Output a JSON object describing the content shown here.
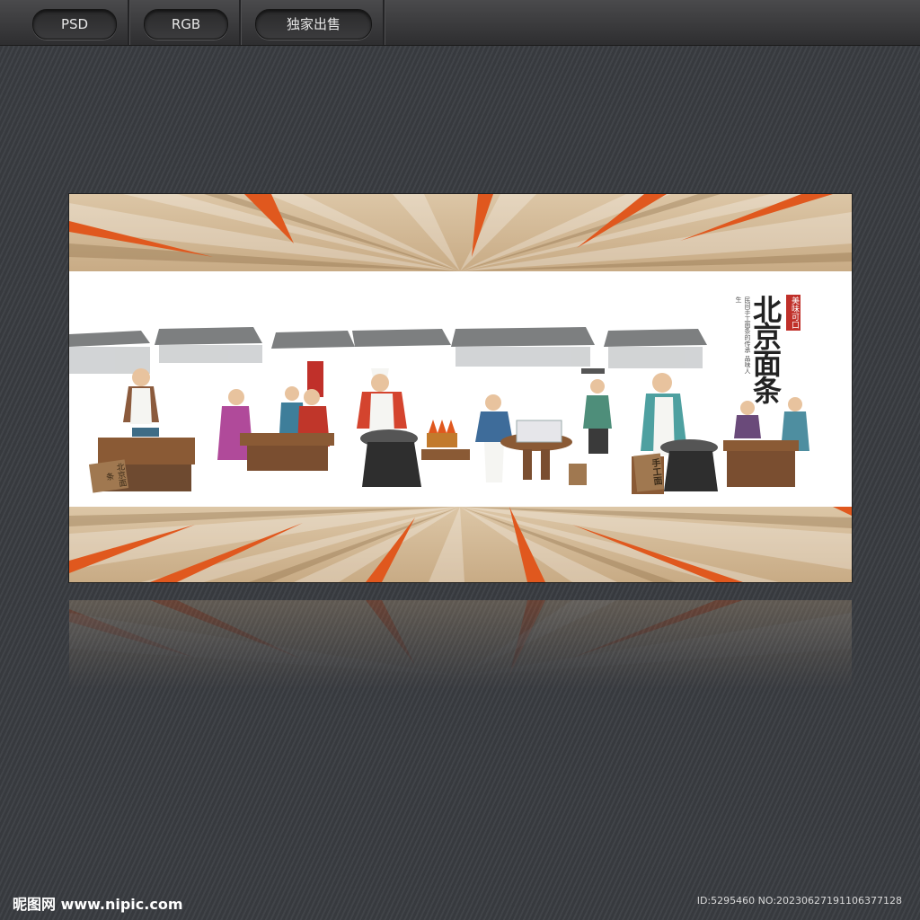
{
  "toolbar": {
    "buttons": [
      {
        "label": "PSD"
      },
      {
        "label": "RGB"
      },
      {
        "label": "独家出售"
      }
    ]
  },
  "banner": {
    "title": "北京面条",
    "badge": "美味可口",
    "vertical_text": "民间手工面条的传承 品味人生",
    "sign_left": "北京面条",
    "sign_right": "手工面"
  },
  "footer": {
    "logo": "昵图网 www.nipic.com",
    "id_text": "ID:5295460 NO:20230627191106377128"
  },
  "colors": {
    "accent_orange": "#e0581e",
    "band_tan": "#d6bf9d",
    "background": "#3a3d42"
  }
}
